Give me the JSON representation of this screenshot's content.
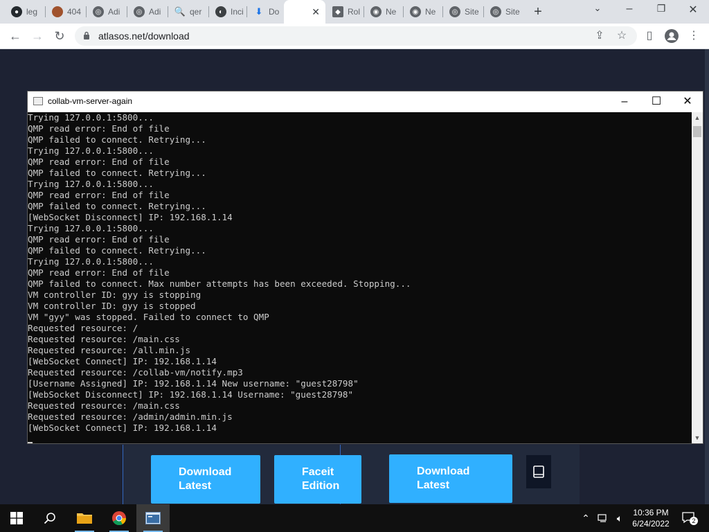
{
  "browser": {
    "tabs": [
      {
        "label": "leg",
        "icon": "github-icon"
      },
      {
        "label": "404",
        "icon": "avatar-icon"
      },
      {
        "label": "Adi",
        "icon": "globe-icon"
      },
      {
        "label": "Adi",
        "icon": "globe-icon"
      },
      {
        "label": "qer",
        "icon": "search-icon"
      },
      {
        "label": "Inci",
        "icon": "mask-icon"
      },
      {
        "label": "Do",
        "icon": "download-icon"
      },
      {
        "label": "",
        "icon": "blank-icon"
      },
      {
        "label": "Rol",
        "icon": "roblox-icon"
      },
      {
        "label": "Ne",
        "icon": "chrome-icon"
      },
      {
        "label": "Ne",
        "icon": "chrome-icon"
      },
      {
        "label": "Site",
        "icon": "globe-icon"
      },
      {
        "label": "Site",
        "icon": "globe-icon"
      }
    ],
    "url": "atlasos.net/download"
  },
  "console": {
    "title": "collab-vm-server-again",
    "lines": [
      "Trying 127.0.0.1:5800...",
      "QMP read error: End of file",
      "QMP failed to connect. Retrying...",
      "Trying 127.0.0.1:5800...",
      "QMP read error: End of file",
      "QMP failed to connect. Retrying...",
      "Trying 127.0.0.1:5800...",
      "QMP read error: End of file",
      "QMP failed to connect. Retrying...",
      "[WebSocket Disconnect] IP: 192.168.1.14",
      "Trying 127.0.0.1:5800...",
      "QMP read error: End of file",
      "QMP failed to connect. Retrying...",
      "Trying 127.0.0.1:5800...",
      "QMP read error: End of file",
      "QMP failed to connect. Max number attempts has been exceeded. Stopping...",
      "VM controller ID: gyy is stopping",
      "VM controller ID: gyy is stopped",
      "VM \"gyy\" was stopped. Failed to connect to QMP",
      "Requested resource: /",
      "Requested resource: /main.css",
      "Requested resource: /all.min.js",
      "[WebSocket Connect] IP: 192.168.1.14",
      "Requested resource: /collab-vm/notify.mp3",
      "[Username Assigned] IP: 192.168.1.14 New username: \"guest28798\"",
      "[WebSocket Disconnect] IP: 192.168.1.14 Username: \"guest28798\"",
      "Requested resource: /main.css",
      "Requested resource: /admin/admin.min.js",
      "[WebSocket Connect] IP: 192.168.1.14"
    ]
  },
  "page": {
    "buttons": [
      {
        "line1": "Download",
        "line2": "Latest"
      },
      {
        "line1": "Faceit",
        "line2": "Edition"
      },
      {
        "line1": "Download",
        "line2": "Latest"
      }
    ],
    "accent_color": "#30b0ff"
  },
  "taskbar": {
    "time": "10:36 PM",
    "date": "6/24/2022",
    "notification_count": "2"
  }
}
